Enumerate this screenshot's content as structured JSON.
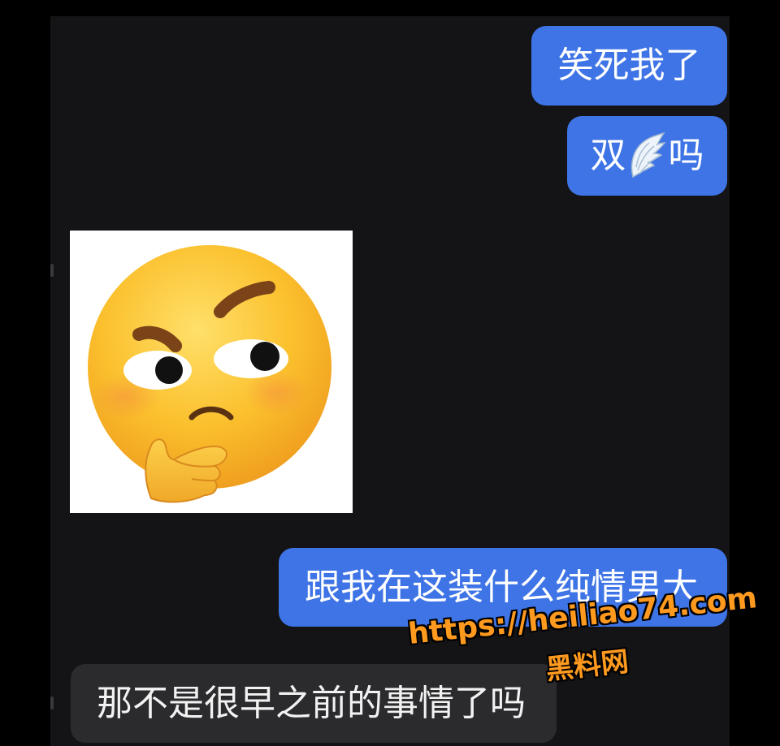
{
  "messages": [
    {
      "direction": "outgoing",
      "text": "笑死我了"
    },
    {
      "direction": "outgoing",
      "text_before": "双",
      "emoji": "wing-emoji",
      "text_after": "吗"
    },
    {
      "direction": "incoming",
      "type": "sticker",
      "sticker": "thinking-face-sticker"
    },
    {
      "direction": "outgoing",
      "text": "跟我在这装什么纯情男大"
    },
    {
      "direction": "incoming",
      "text": "那不是很早之前的事情了吗"
    }
  ],
  "watermark": {
    "url": "https://heiliao74.com",
    "name": "黑料网"
  },
  "colors": {
    "outgoing_bubble": "#3e74e6",
    "incoming_bubble": "#2b2b2e",
    "chat_background": "#141416",
    "watermark": "#ff9a1f"
  }
}
